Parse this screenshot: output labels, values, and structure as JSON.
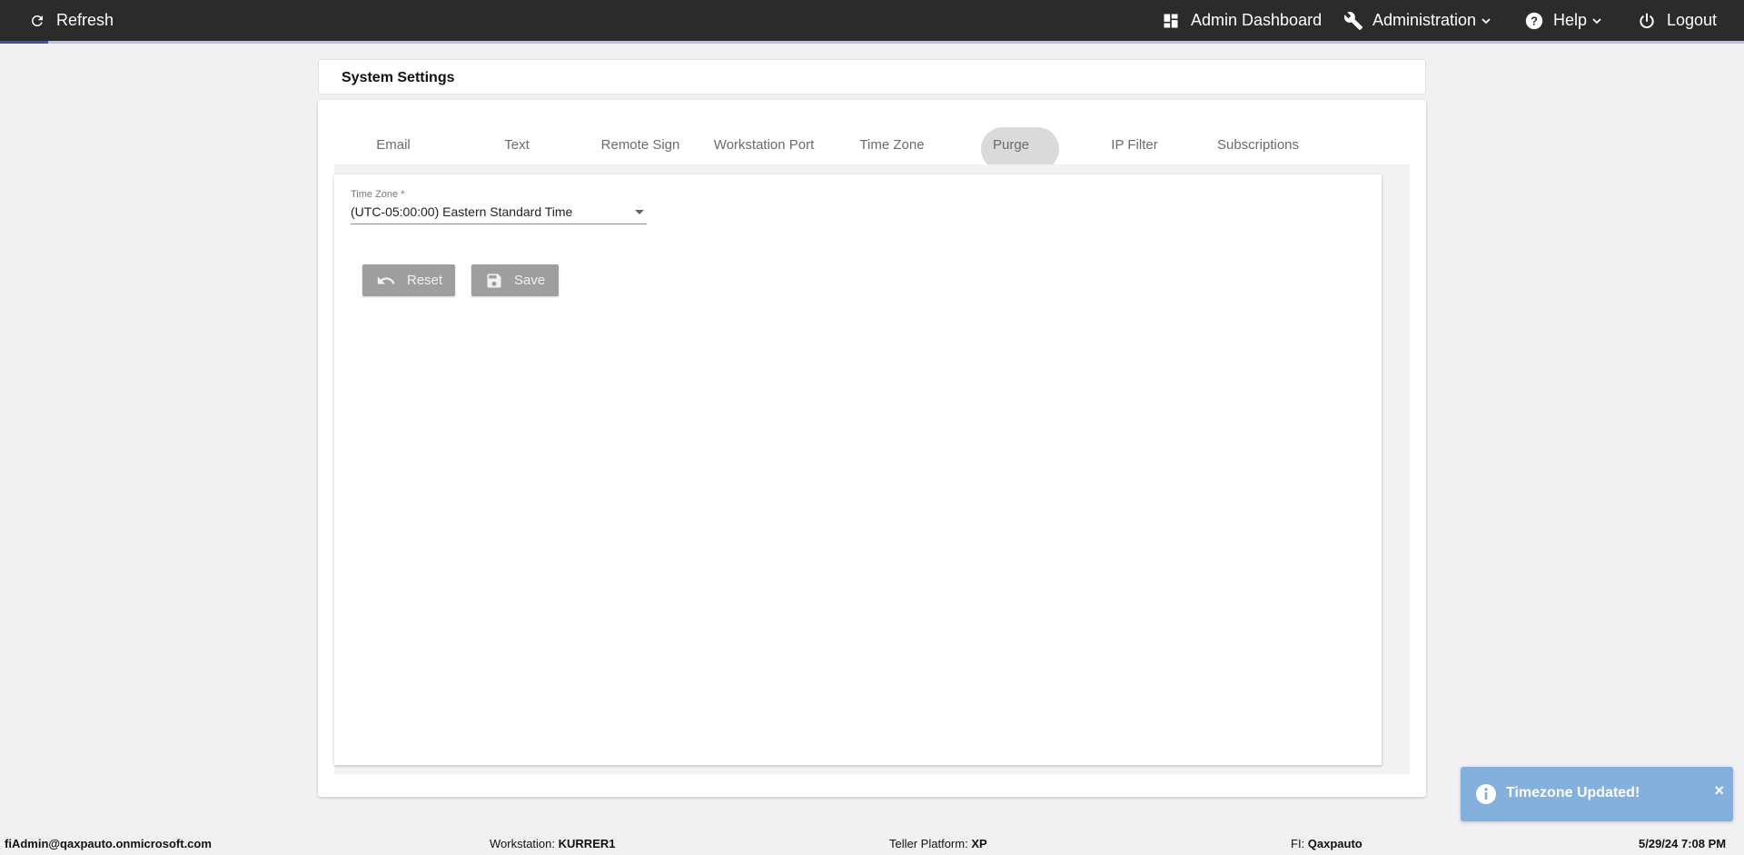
{
  "topbar": {
    "refresh_label": "Refresh",
    "admin_dashboard_label": "Admin Dashboard",
    "administration_label": "Administration",
    "help_label": "Help",
    "logout_label": "Logout"
  },
  "page": {
    "title": "System Settings"
  },
  "tabs": [
    {
      "label": "Email"
    },
    {
      "label": "Text"
    },
    {
      "label": "Remote Sign"
    },
    {
      "label": "Workstation Port"
    },
    {
      "label": "Time Zone"
    },
    {
      "label": "Purge"
    },
    {
      "label": "IP Filter"
    },
    {
      "label": "Subscriptions"
    }
  ],
  "active_tab": "Time Zone",
  "timezone_form": {
    "field_label": "Time Zone *",
    "selected_value": "(UTC-05:00:00) Eastern Standard Time",
    "reset_label": "Reset",
    "save_label": "Save"
  },
  "toast": {
    "message": "Timezone Updated!",
    "close_glyph": "×"
  },
  "statusbar": {
    "user": "fiAdmin@qaxpauto.onmicrosoft.com",
    "workstation_label": "Workstation:",
    "workstation_value": "KURRER1",
    "teller_platform_label": "Teller Platform:",
    "teller_platform_value": "XP",
    "fi_label": "FI:",
    "fi_value": "Qaxpauto",
    "datetime": "5/29/24 7:08 PM"
  },
  "colors": {
    "topbar_bg": "#2b2b2b",
    "accent": "#3f51b5",
    "button_disabled": "#9e9e9e",
    "toast_bg": "#84b0dd"
  },
  "icons": {
    "refresh": "refresh-icon",
    "dashboard": "dashboard-icon",
    "administration": "wrench-icon",
    "help": "help-circle-icon",
    "logout": "power-icon",
    "reset": "undo-icon",
    "save": "floppy-disk-icon",
    "toast": "info-icon"
  }
}
